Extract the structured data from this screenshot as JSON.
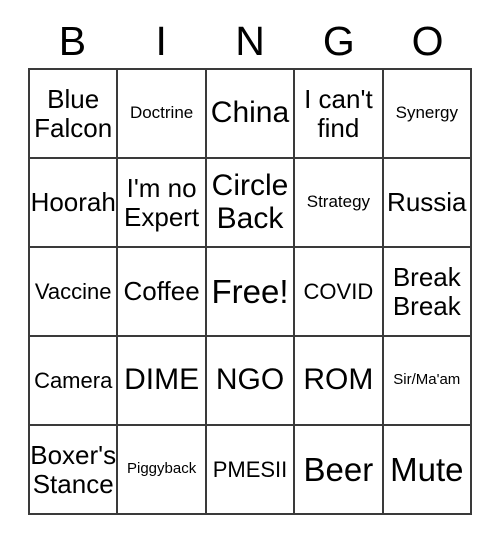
{
  "card": {
    "header_letters": [
      "B",
      "I",
      "N",
      "G",
      "O"
    ],
    "rows": [
      [
        {
          "text": "Blue\nFalcon",
          "size": "l"
        },
        {
          "text": "Doctrine",
          "size": "s"
        },
        {
          "text": "China",
          "size": "xl"
        },
        {
          "text": "I can't\nfind",
          "size": "l"
        },
        {
          "text": "Synergy",
          "size": "s"
        }
      ],
      [
        {
          "text": "Hoorah",
          "size": "l"
        },
        {
          "text": "I'm no\nExpert",
          "size": "l"
        },
        {
          "text": "Circle\nBack",
          "size": "xl"
        },
        {
          "text": "Strategy",
          "size": "s"
        },
        {
          "text": "Russia",
          "size": "l"
        }
      ],
      [
        {
          "text": "Vaccine",
          "size": "m"
        },
        {
          "text": "Coffee",
          "size": "l"
        },
        {
          "text": "Free!",
          "size": "xxl"
        },
        {
          "text": "COVID",
          "size": "m"
        },
        {
          "text": "Break\nBreak",
          "size": "l"
        }
      ],
      [
        {
          "text": "Camera",
          "size": "m"
        },
        {
          "text": "DIME",
          "size": "xl"
        },
        {
          "text": "NGO",
          "size": "xl"
        },
        {
          "text": "ROM",
          "size": "xl"
        },
        {
          "text": "Sir/Ma'am",
          "size": "xs"
        }
      ],
      [
        {
          "text": "Boxer's\nStance",
          "size": "l"
        },
        {
          "text": "Piggyback",
          "size": "xs"
        },
        {
          "text": "PMESII",
          "size": "m"
        },
        {
          "text": "Beer",
          "size": "xxl"
        },
        {
          "text": "Mute",
          "size": "xxl"
        }
      ]
    ],
    "colors": {
      "background": "#ffffff",
      "text": "#000000",
      "grid_line": "#3a3a3a"
    }
  }
}
